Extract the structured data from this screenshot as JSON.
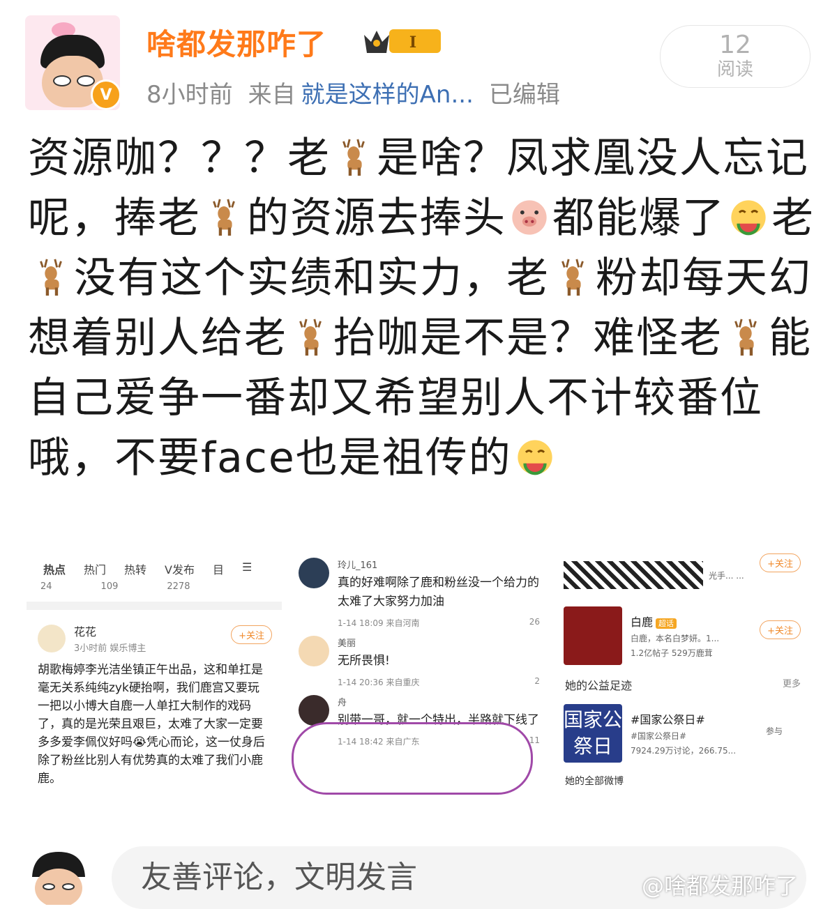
{
  "header": {
    "username": "啥都发那咋了",
    "vip_level": "I",
    "time": "8小时前",
    "source_prefix": "来自",
    "source": "就是这样的An...",
    "edited": "已编辑",
    "read_count": "12",
    "read_label": "阅读"
  },
  "post": {
    "segments": [
      "资源咖？？？老",
      "是啥？凤求凰没人忘记呢，捧老",
      "的资源去捧头",
      "都能爆了",
      "老",
      "没有这个实绩和实力，老",
      "粉却每天幻想着别人给老",
      "抬咖是不是？难怪老",
      "能自己爱争一番却又希望别人不计较番位哦，不要face也是祖传的"
    ]
  },
  "shot1": {
    "tabs": [
      "热点",
      "热门",
      "热转",
      "V发布",
      "目",
      "☰"
    ],
    "stats": [
      "24",
      "109",
      "2278"
    ],
    "author": "花花",
    "time": "3小时前  娱乐博主",
    "follow": "+关注",
    "body": "胡歌梅婷李光洁坐镇正午出品，这和单扛是毫无关系纯纯zyk硬抬啊，我们鹿宫又要玩一把以小博大自鹿一人单扛大制作的戏码了，真的是光荣且艰巨，太难了大家一定要多多爱李佩仪好吗😭凭心而论，这一仗身后除了粉丝比别人有优势真的太难了我们小鹿鹿。"
  },
  "shot2": {
    "comments": [
      {
        "name": "玲儿_161",
        "text": "真的好难啊除了鹿和粉丝没一个给力的太难了大家努力加油",
        "time": "1-14 18:09 来自河南",
        "likes": "26"
      },
      {
        "name": "美丽",
        "text": "无所畏惧!",
        "time": "1-14 20:36 来自重庆",
        "likes": "2"
      },
      {
        "name": "舟",
        "text": "别带一哥，就一个特出，半路就下线了",
        "time": "1-14 18:42 来自广东",
        "likes": "11"
      }
    ]
  },
  "shot3": {
    "follow": "+关注",
    "top_text": "光手... ...",
    "topic1_title": "白鹿",
    "topic1_tag": "超话",
    "topic1_desc": "白鹿，本名白梦妍。1...",
    "topic1_stats": "1.2亿帖子 529万鹿茸",
    "section_title": "她的公益足迹",
    "section_more": "更多",
    "topic2_image_text": "国家公祭日",
    "topic2_title": "#国家公祭日#",
    "topic2_sub": "#国家公祭日#",
    "topic2_stats": "7924.29万讨论，266.75...",
    "topic2_action": "参与",
    "footer": "她的全部微博"
  },
  "bottom": {
    "placeholder": "友善评论，文明发言",
    "watermark": "@啥都发那咋了"
  },
  "colors": {
    "username": "#ff7a1a",
    "source_link": "#3d6fb3",
    "meta": "#8a8a8a",
    "circle": "#a049a8"
  }
}
